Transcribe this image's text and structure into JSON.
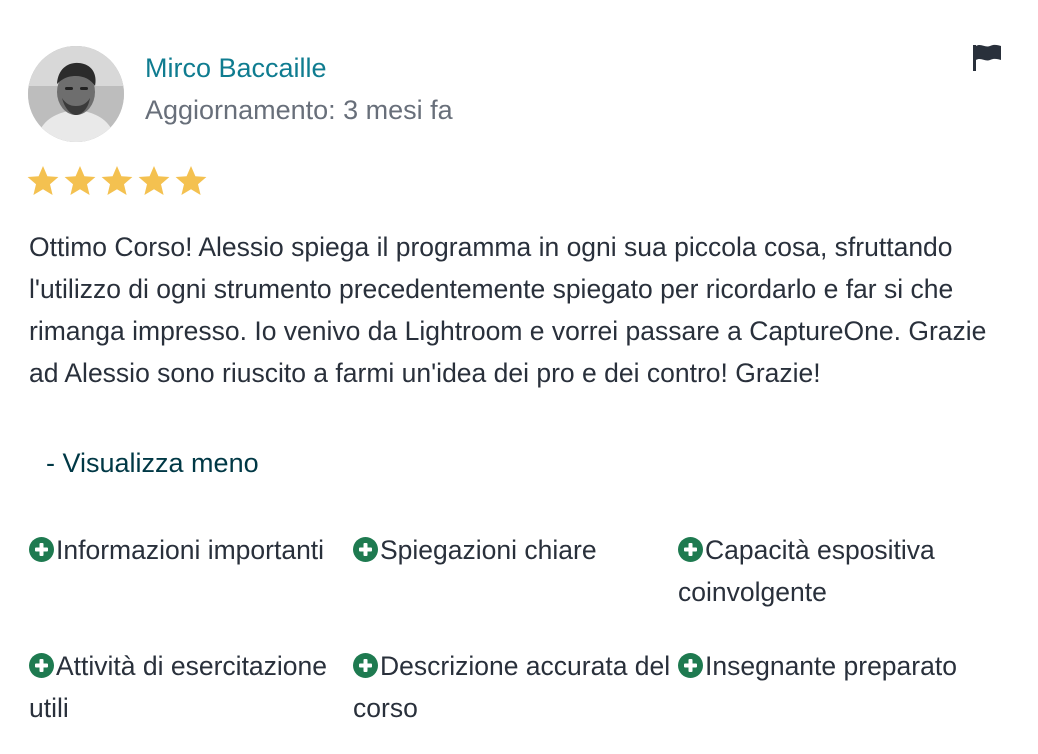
{
  "reviewer": {
    "name": "Mirco Baccaille",
    "updated": "Aggiornamento: 3 mesi fa",
    "avatar_icon": "user-avatar-photo"
  },
  "report_icon": "flag-icon",
  "rating": {
    "stars": 5,
    "max": 5,
    "color": "#f4c150"
  },
  "review": {
    "text": "Ottimo Corso! Alessio spiega il programma in ogni sua piccola cosa, sfruttando l'utilizzo di ogni strumento precedentemente spiegato per ricordarlo e far si che rimanga impresso. Io venivo da Lightroom e vorrei passare a CaptureOne. Grazie ad Alessio sono riuscito a farmi un'idea dei pro e dei contro! Grazie!",
    "toggle_label": "- Visualizza meno"
  },
  "tags": [
    {
      "label": "Informazioni importanti"
    },
    {
      "label": "Spiegazioni chiare"
    },
    {
      "label": "Capacità espositiva coinvolgente"
    },
    {
      "label": "Attività di esercitazione utili"
    },
    {
      "label": "Descrizione accurata del corso"
    },
    {
      "label": "Insegnante preparato"
    }
  ],
  "colors": {
    "name_link": "#0f7c90",
    "muted": "#686f7a",
    "text": "#29303b",
    "toggle_link": "#003845",
    "tag_plus": "#1e7a50",
    "star": "#f4c150"
  }
}
